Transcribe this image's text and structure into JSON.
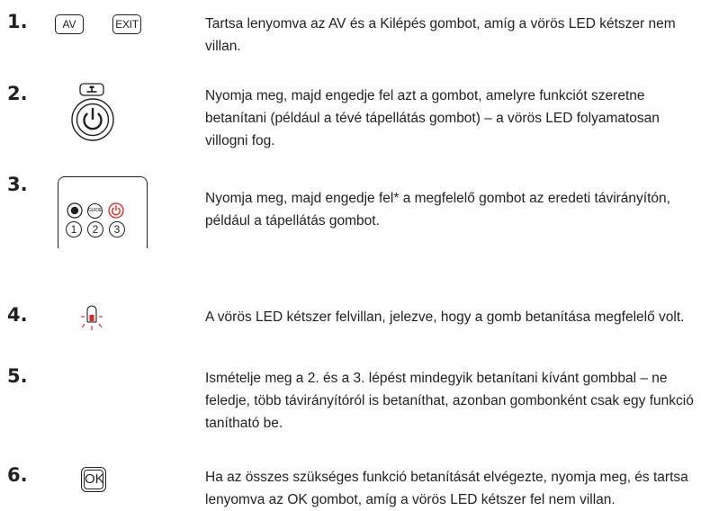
{
  "steps": [
    {
      "number": "1.",
      "text": "Tartsa lenyomva az AV és a Kilépés gombot, amíg a vörös LED kétszer nem villan.",
      "icon": "av-exit-keys",
      "keys": [
        "AV",
        "EXIT"
      ]
    },
    {
      "number": "2.",
      "text": "Nyomja meg, majd engedje fel azt a gombot, amelyre funkciót szeretne betanítani (például a tévé tápellátás gombot) – a vörös LED folyamatosan villogni fog.",
      "icon": "learn-and-power-keys"
    },
    {
      "number": "3.",
      "text": "Nyomja meg, majd engedje fel* a megfelelő gombot az eredeti távirányítón, például a tápellátás gombot.",
      "icon": "original-remote",
      "remote": {
        "guide": "GUIDE",
        "digits": [
          "1",
          "2",
          "3"
        ]
      }
    },
    {
      "number": "4.",
      "text": "A vörös LED kétszer felvillan, jelezve, hogy a gomb betanítása megfelelő volt.",
      "icon": "blinking-red-led"
    },
    {
      "number": "5.",
      "text": "Ismételje meg a 2. és a 3. lépést mindegyik betanítani kívánt gombbal – ne feledje, több távirányítóról is betaníthat, azonban gombonként csak egy funkció tanítható be.",
      "icon": ""
    },
    {
      "number": "6.",
      "text": "Ha az összes szükséges funkció betanítását elvégezte, nyomja meg, és tartsa lenyomva az OK gombot, amíg a vörös LED kétszer fel nem villan.",
      "icon": "ok-key",
      "keys": [
        "OK"
      ]
    }
  ],
  "colors": {
    "text": "#231f20",
    "led_red": "#e2231a"
  }
}
